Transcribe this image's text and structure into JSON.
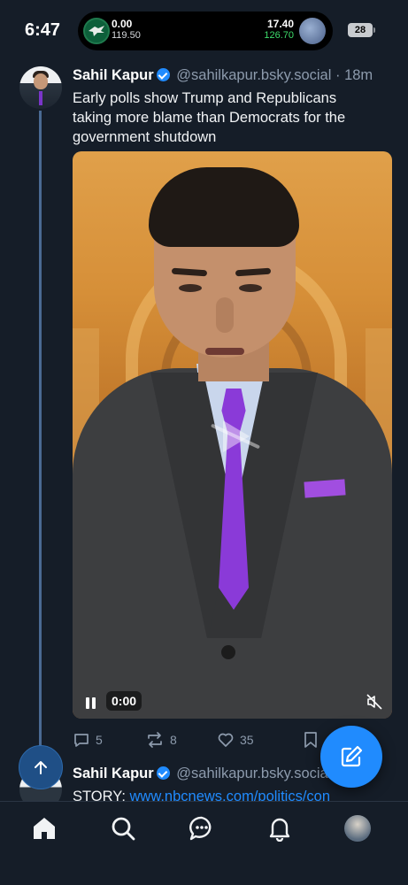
{
  "status_bar": {
    "time": "6:47",
    "score_left_main": "0.00",
    "score_left_sub": "119.50",
    "score_right_main": "17.40",
    "score_right_sub": "126.70",
    "battery": "28"
  },
  "post": {
    "author": "Sahil Kapur",
    "handle": "@sahilkapur.bsky.social",
    "separator": "·",
    "age": "18m",
    "text": "Early polls show Trump and Republicans taking more blame than Democrats for the government shutdown",
    "video_time": "0:00",
    "replies": "5",
    "reposts": "8",
    "likes": "35"
  },
  "post2": {
    "author": "Sahil Kapur",
    "handle": "@sahilkapur.bsky.social",
    "text_prefix": "STORY: ",
    "link": "www.nbcnews.com/politics/con"
  },
  "colors": {
    "accent": "#208bfe",
    "background": "#151d28",
    "muted": "#8d9bad"
  },
  "tabs": [
    "home-icon",
    "search-icon",
    "chat-icon",
    "bell-icon",
    "profile-avatar"
  ]
}
